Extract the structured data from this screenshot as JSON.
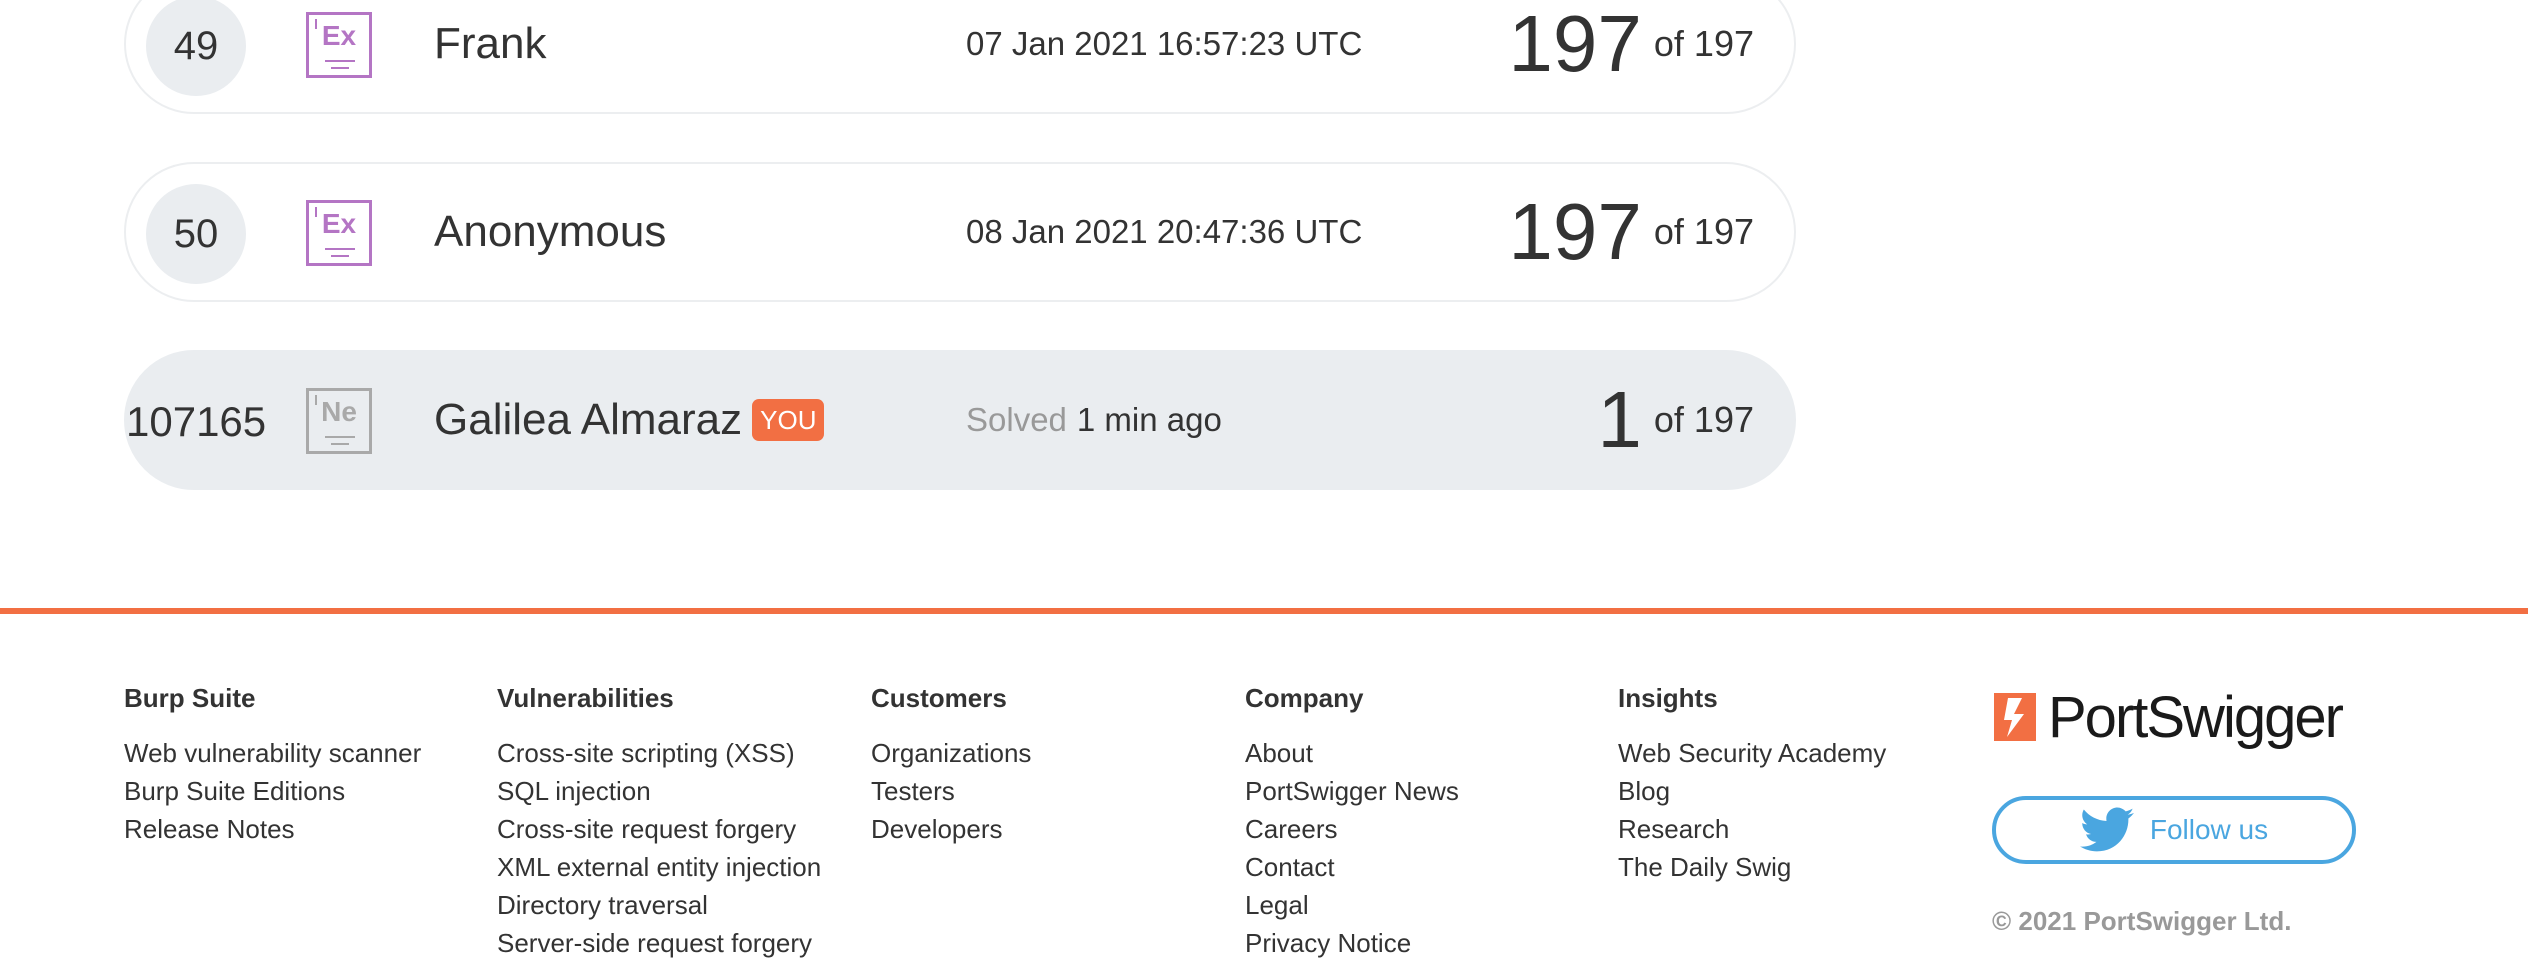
{
  "leaderboard": {
    "rows": [
      {
        "rank": "49",
        "badge": "Ex",
        "name": "Frank",
        "date": "07 Jan 2021 16:57:23 UTC",
        "score": "197",
        "of": "of 197"
      },
      {
        "rank": "50",
        "badge": "Ex",
        "name": "Anonymous",
        "date": "08 Jan 2021 20:47:36 UTC",
        "score": "197",
        "of": "of 197"
      }
    ],
    "you": {
      "rank": "107165",
      "badge": "Ne",
      "name": "Galilea Almaraz",
      "tag": "YOU",
      "solved_label": "Solved",
      "solved_time": "1 min ago",
      "score": "1",
      "of": "of 197"
    }
  },
  "footer": {
    "columns": [
      {
        "title": "Burp Suite",
        "links": [
          "Web vulnerability scanner",
          "Burp Suite Editions",
          "Release Notes"
        ]
      },
      {
        "title": "Vulnerabilities",
        "links": [
          "Cross-site scripting (XSS)",
          "SQL injection",
          "Cross-site request forgery",
          "XML external entity injection",
          "Directory traversal",
          "Server-side request forgery"
        ]
      },
      {
        "title": "Customers",
        "links": [
          "Organizations",
          "Testers",
          "Developers"
        ]
      },
      {
        "title": "Company",
        "links": [
          "About",
          "PortSwigger News",
          "Careers",
          "Contact",
          "Legal",
          "Privacy Notice"
        ]
      },
      {
        "title": "Insights",
        "links": [
          "Web Security Academy",
          "Blog",
          "Research",
          "The Daily Swig"
        ]
      }
    ],
    "brand": "PortSwigger",
    "follow_label": "Follow us",
    "follow_icon": "twitter-icon",
    "copyright": "© 2021 PortSwigger Ltd."
  },
  "colors": {
    "accent": "#f26f43",
    "twitter": "#4aa6e0",
    "badge_expert": "#b475c4",
    "badge_grey": "#a9a9a9",
    "row_highlight": "#eaedf0"
  }
}
